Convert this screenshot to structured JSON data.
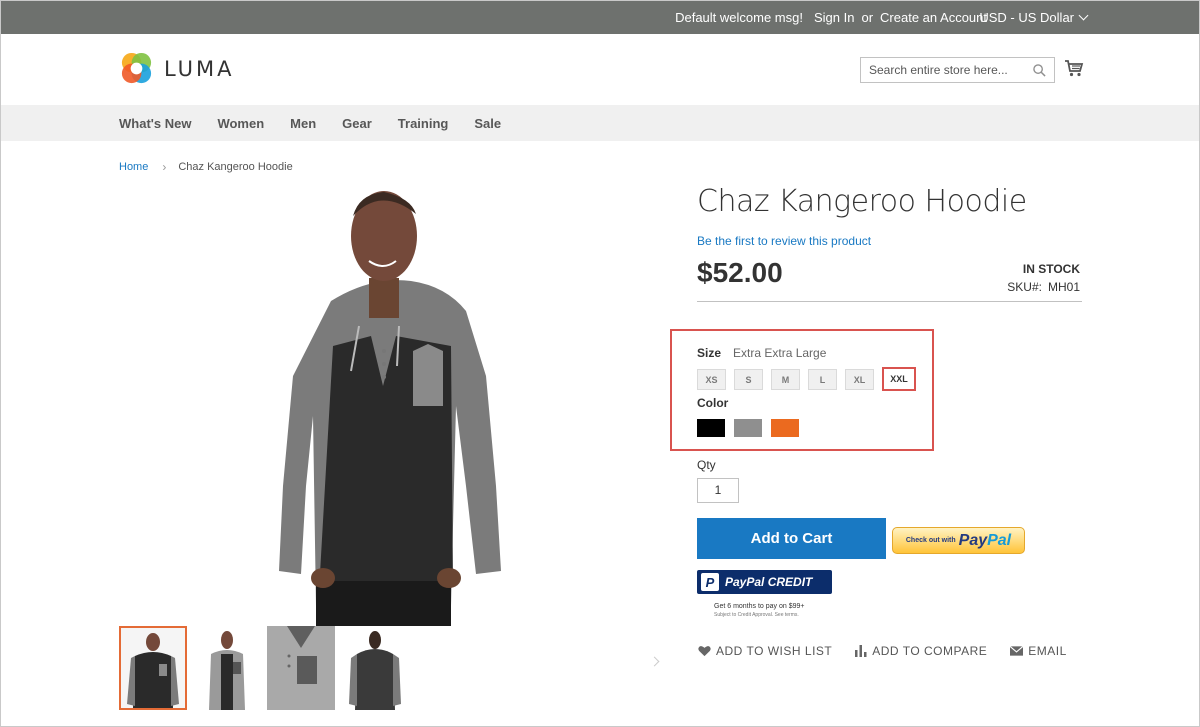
{
  "panel": {
    "welcome": "Default welcome msg!",
    "sign_in": "Sign In",
    "or": "or",
    "create_account": "Create an Account",
    "currency": "USD - US Dollar"
  },
  "header": {
    "logo_text": "LUMA",
    "search_placeholder": "Search entire store here..."
  },
  "nav": {
    "items": [
      "What's New",
      "Women",
      "Men",
      "Gear",
      "Training",
      "Sale"
    ]
  },
  "breadcrumb": {
    "home": "Home",
    "current": "Chaz Kangeroo Hoodie"
  },
  "product": {
    "title": "Chaz Kangeroo Hoodie",
    "review_link": "Be the first to review this product",
    "price": "$52.00",
    "stock": "IN STOCK",
    "sku_label": "SKU#:",
    "sku": "MH01",
    "size_label": "Size",
    "size_selected": "Extra Extra Large",
    "sizes": [
      "XS",
      "S",
      "M",
      "L",
      "XL",
      "XXL"
    ],
    "color_label": "Color",
    "colors": [
      "#000000",
      "#8f8f8f",
      "#eb6a1f"
    ],
    "qty_label": "Qty",
    "qty": "1",
    "add_to_cart": "Add to Cart",
    "paypal_checkout_small": "Check out with",
    "paypal_pay": "Pay",
    "paypal_pal": "Pal",
    "paypal_credit": "PayPal CREDIT",
    "credit_note": "Get 6 months to pay on $99+",
    "credit_terms": "Subject to Credit Approval. See terms.",
    "actions": {
      "wishlist": "ADD TO WISH LIST",
      "compare": "ADD TO COMPARE",
      "email": "EMAIL"
    }
  },
  "colors": {
    "accent_blue": "#1979c3",
    "highlight_red": "#d9534f",
    "thumb_active": "#e46b36"
  }
}
